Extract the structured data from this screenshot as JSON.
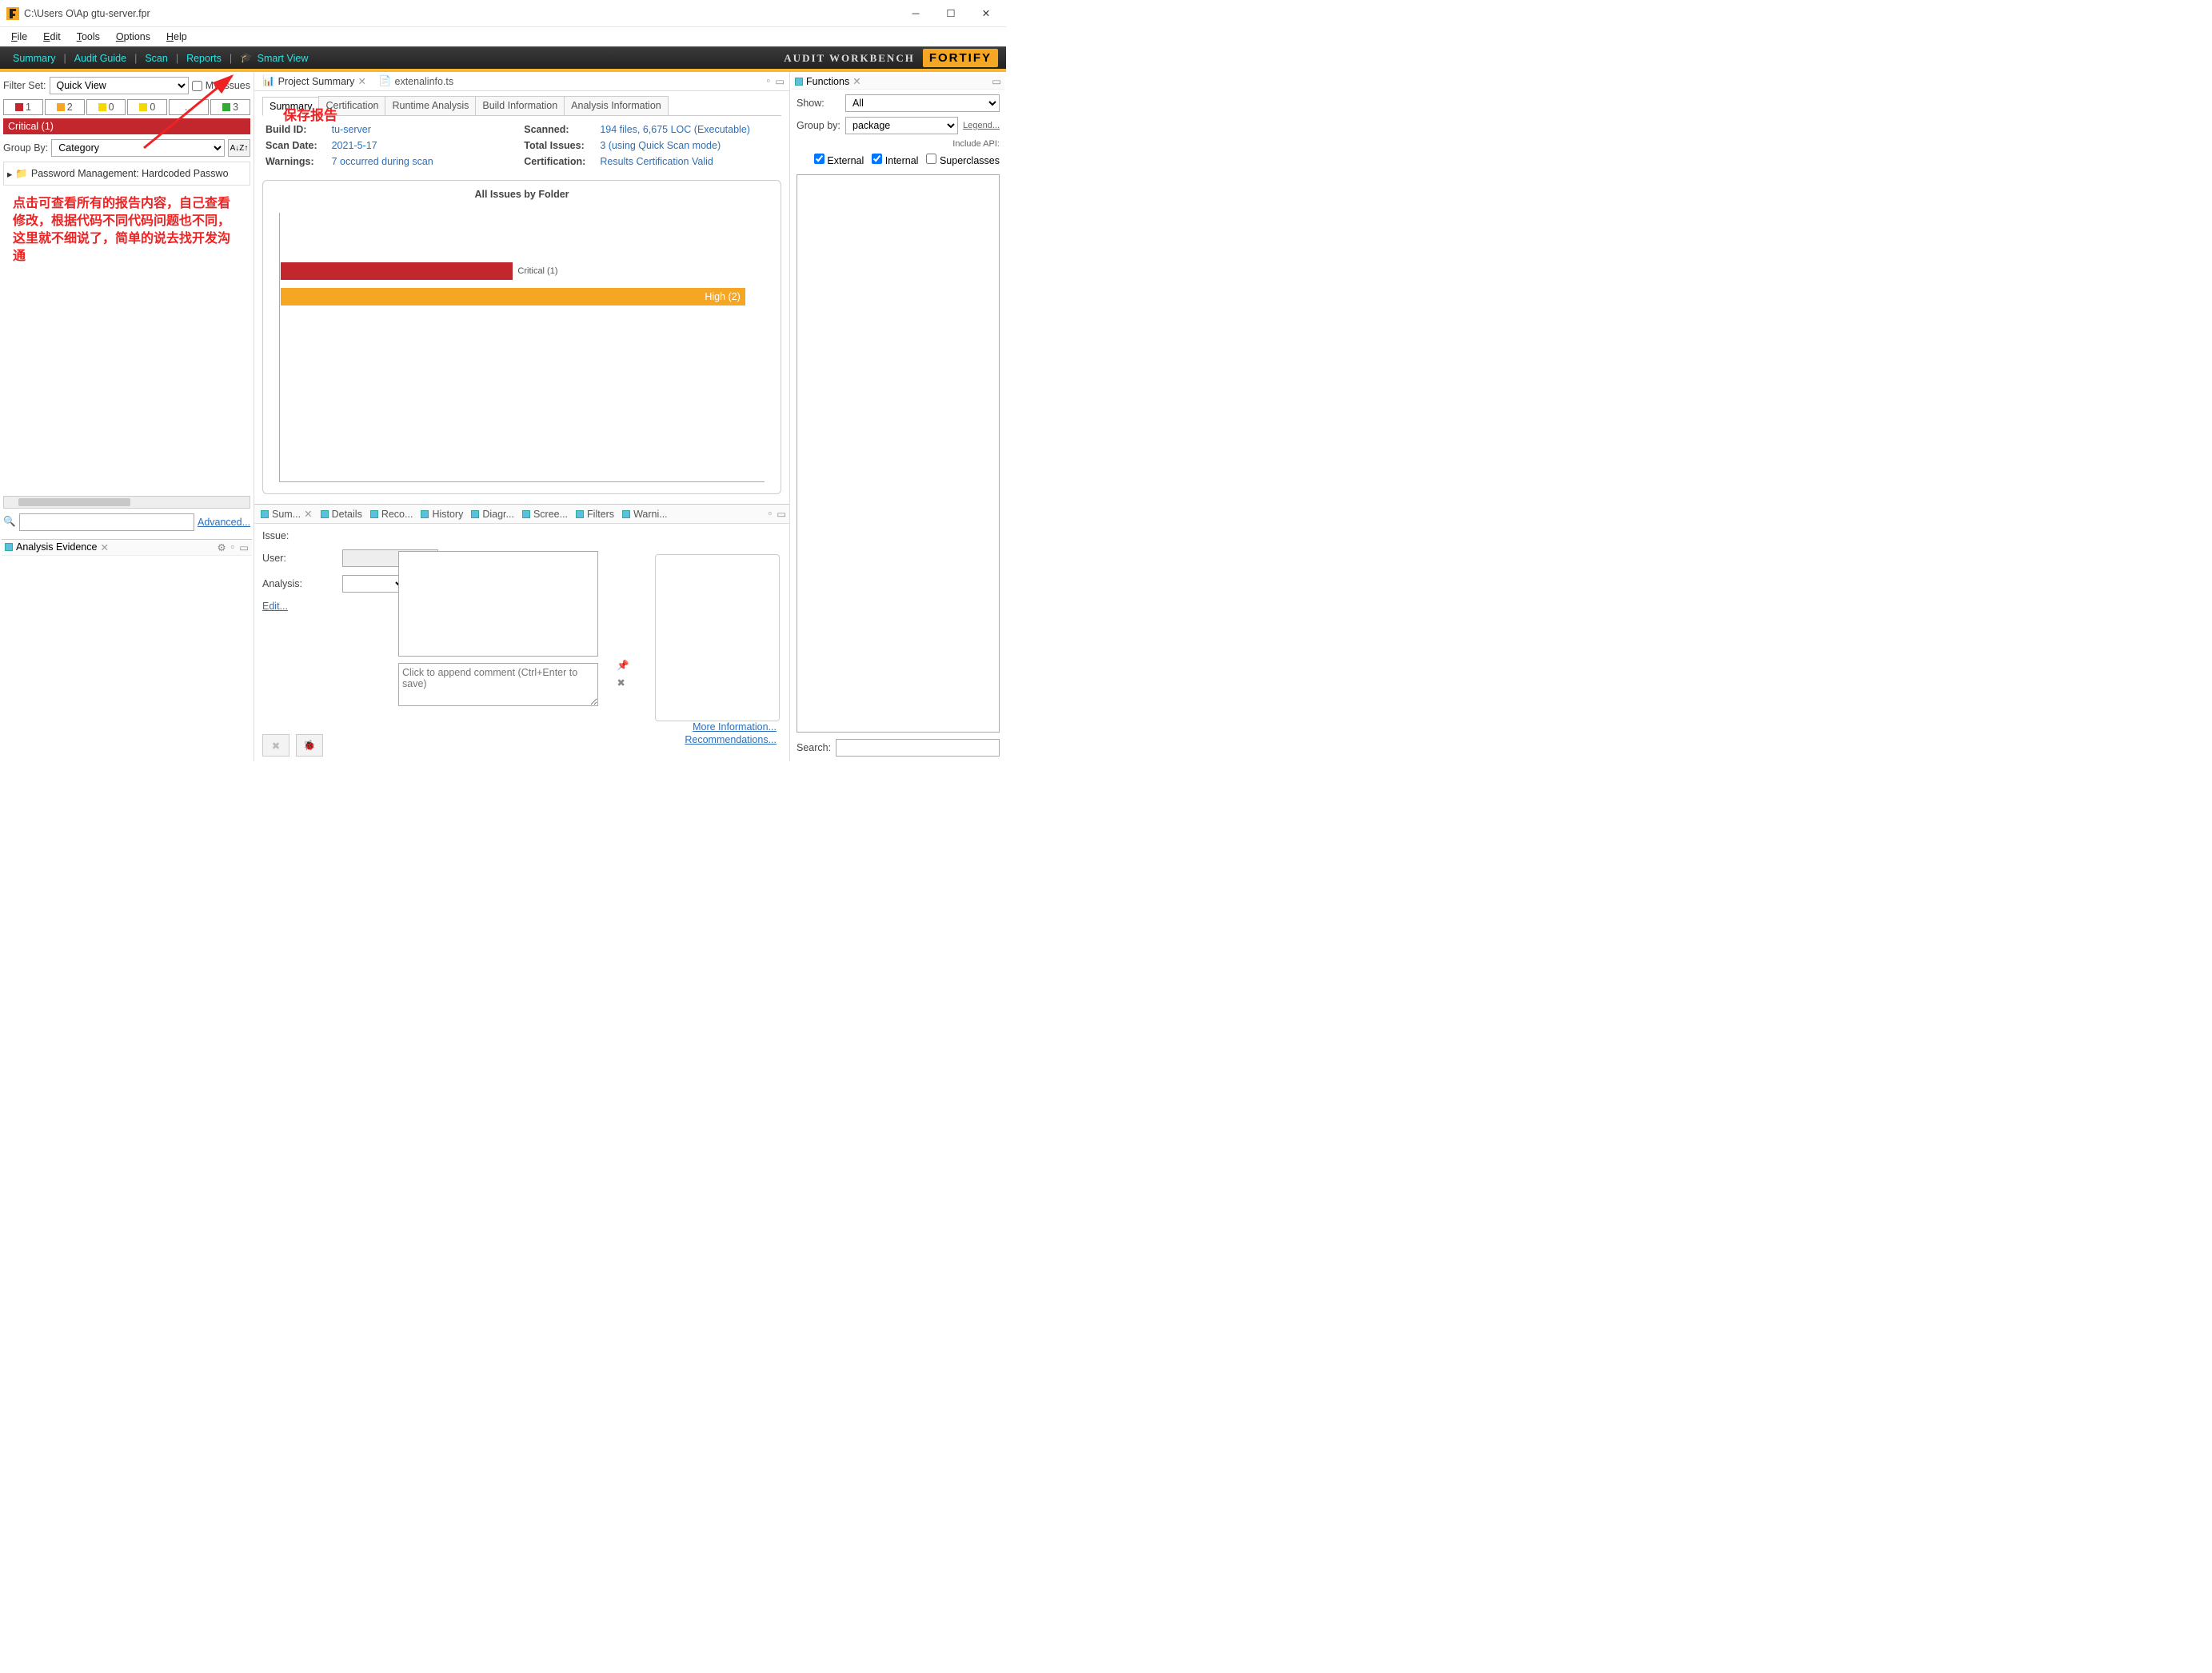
{
  "title": "C:\\Users    O\\Ap              gtu-server.fpr",
  "menus": {
    "file": "File",
    "edit": "Edit",
    "tools": "Tools",
    "options": "Options",
    "help": "Help"
  },
  "toolbar": {
    "summary": "Summary",
    "audit_guide": "Audit Guide",
    "scan": "Scan",
    "reports": "Reports",
    "smart_view": "Smart View"
  },
  "brand": {
    "text": "AUDIT WORKBENCH",
    "logo": "FORTIFY"
  },
  "filter": {
    "label": "Filter Set:",
    "value": "Quick View",
    "my_issues": "My Issues"
  },
  "sev": {
    "s1": "1",
    "s2": "2",
    "s3": "0",
    "s4": "0",
    "s5": "...",
    "s6": "3"
  },
  "critical_bar": "Critical (1)",
  "groupby": {
    "label": "Group By:",
    "value": "Category",
    "sort": "A↓Z↑"
  },
  "tree_item": "Password Management: Hardcoded Passwo",
  "annotation_left": "点击可查看所有的报告内容，自己查看修改，根据代码不同代码问题也不同，这里就不细说了，简单的说去找开发沟通",
  "annotation_top": "保存报告",
  "advanced": "Advanced...",
  "evidence": {
    "title": "Analysis Evidence"
  },
  "mid_tabs": {
    "project_summary": "Project Summary",
    "external": "extenalinfo.ts"
  },
  "subtabs": {
    "summary": "Summary",
    "certification": "Certification",
    "runtime": "Runtime Analysis",
    "build": "Build Information",
    "analysis": "Analysis Information"
  },
  "info": {
    "build_id_k": "Build ID:",
    "build_id_v": "tu-server",
    "scan_date_k": "Scan Date:",
    "scan_date_v": "2021-5-17",
    "warnings_k": "Warnings:",
    "warnings_v": "7 occurred during scan",
    "scanned_k": "Scanned:",
    "scanned_v": "194 files, 6,675 LOC (Executable)",
    "total_k": "Total Issues:",
    "total_v": "3 (using Quick Scan mode)",
    "cert_k": "Certification:",
    "cert_v": "Results Certification Valid"
  },
  "chart_data": {
    "type": "bar",
    "title": "All Issues by Folder",
    "orientation": "horizontal",
    "categories": [
      "Critical",
      "High"
    ],
    "values": [
      1,
      2
    ],
    "labels": [
      "Critical (1)",
      "High (2)"
    ],
    "colors": [
      "#c1272d",
      "#f5a623"
    ],
    "ylim": [
      0,
      2
    ]
  },
  "btabs": {
    "sum": "Sum...",
    "details": "Details",
    "reco": "Reco...",
    "history": "History",
    "diagr": "Diagr...",
    "scree": "Scree...",
    "filters": "Filters",
    "warni": "Warni..."
  },
  "issue": {
    "issue_k": "Issue:",
    "user_k": "User:",
    "analysis_k": "Analysis:",
    "edit": "Edit...",
    "comment_ph": "Click to append comment (Ctrl+Enter to save)",
    "more_info": "More Information...",
    "recommendations": "Recommendations..."
  },
  "functions": {
    "title": "Functions",
    "show_k": "Show:",
    "show_v": "All",
    "groupby_k": "Group by:",
    "groupby_v": "package",
    "legend": "Legend...",
    "include_api": "Include API:",
    "external": "External",
    "internal": "Internal",
    "super": "Superclasses",
    "search_k": "Search:"
  }
}
